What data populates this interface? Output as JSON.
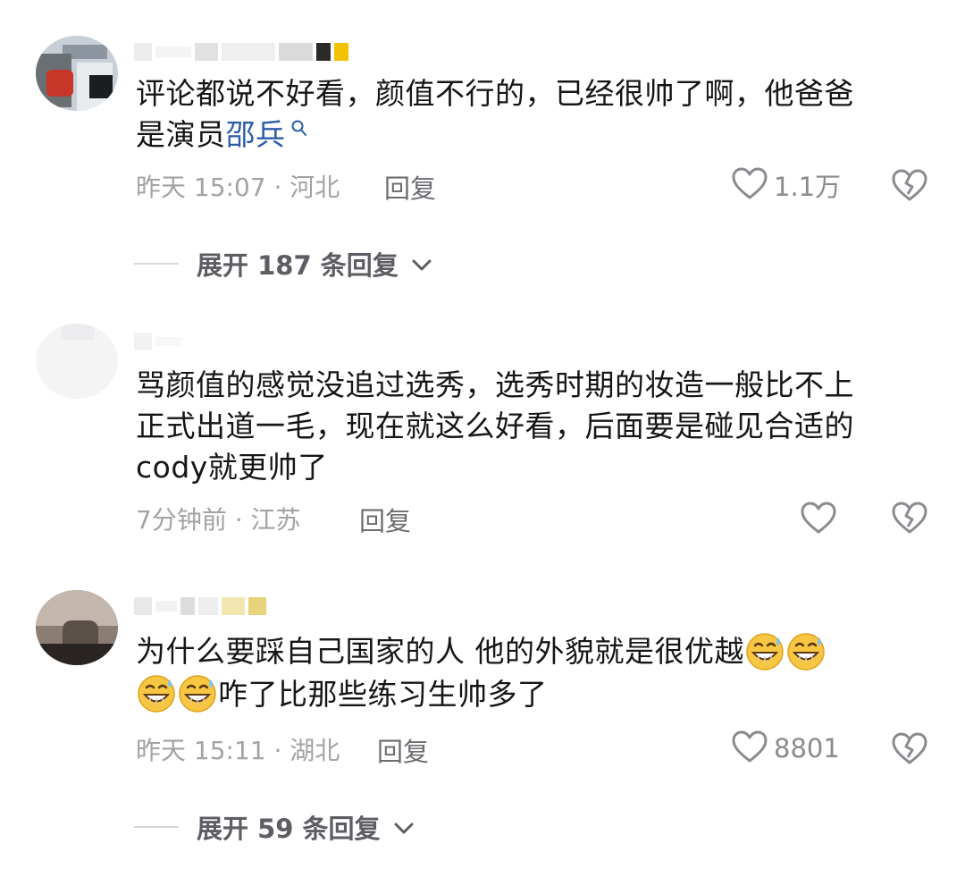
{
  "comments": [
    {
      "text_before_link": "评论都说不好看，颜值不行的，已经很帅了啊，他爸爸",
      "line2_prefix": "是演员",
      "link_text": "邵兵",
      "time": "昨天 15:07",
      "location": "河北",
      "reply_label": "回复",
      "like_count": "1.1万",
      "expand_label": "展开 187 条回复"
    },
    {
      "lines": [
        "骂颜值的感觉没追过选秀，选秀时期的妆造一般比不上",
        "正式出道一毛，现在就这么好看，后面要是碰见合适的",
        "cody就更帅了"
      ],
      "time": "7分钟前",
      "location": "江苏",
      "reply_label": "回复",
      "like_count": ""
    },
    {
      "line1": "为什么要踩自己国家的人  他的外貌就是很优越",
      "line2": "咋了比那些练习生帅多了",
      "emoji_name": "grinning-sweat-emoji",
      "time": "昨天 15:11",
      "location": "湖北",
      "reply_label": "回复",
      "like_count": "8801",
      "expand_label": "展开 59 条回复"
    }
  ],
  "icons": {
    "like": "heart-outline-icon",
    "dislike": "broken-heart-icon",
    "search": "search-icon",
    "expand": "chevron-down-icon"
  },
  "colors": {
    "link": "#2a5ea8",
    "meta": "#a2a2a7",
    "text": "#161616"
  }
}
